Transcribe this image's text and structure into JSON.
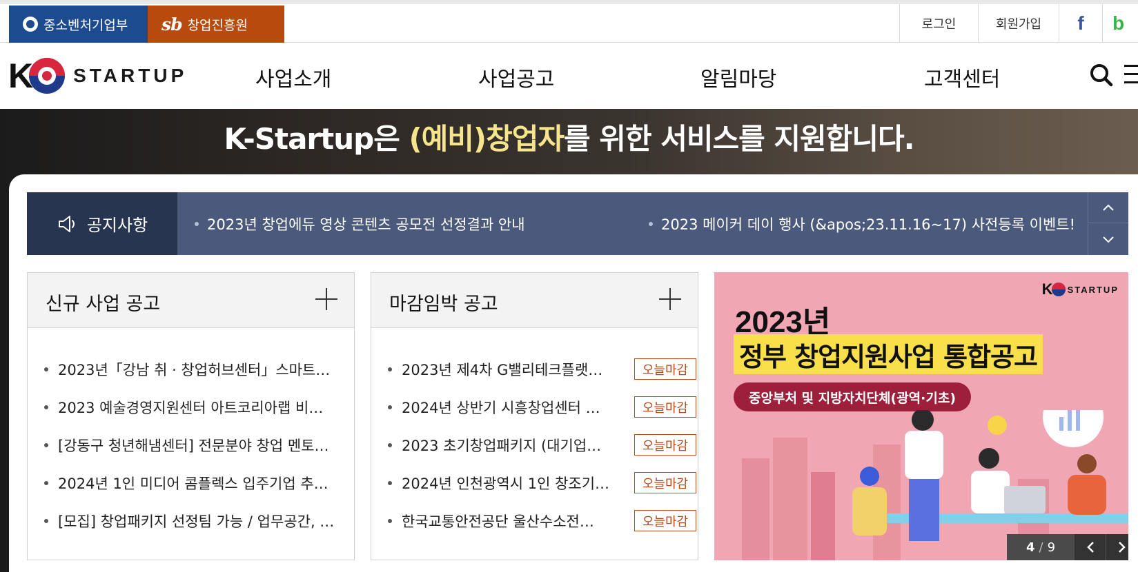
{
  "topbar": {
    "org_mss": "중소벤처기업부",
    "org_kised_mark": "sb",
    "org_kised": "창업진흥원",
    "login": "로그인",
    "join": "회원가입",
    "facebook_glyph": "f",
    "blog_glyph": "b",
    "colors": {
      "mss": "#1d4b8f",
      "kised": "#b94a0e"
    }
  },
  "header": {
    "logo_k": "K",
    "logo_word": "STARTUP",
    "nav": [
      "사업소개",
      "사업공고",
      "알림마당",
      "고객센터"
    ],
    "icons": [
      "search-icon",
      "menu-icon"
    ]
  },
  "hero": {
    "title_pre": "K-Startup은 ",
    "title_highlight": "(예비)창업자",
    "title_post": "를 위한 서비스를 지원합니다."
  },
  "notice": {
    "label": "공지사항",
    "items": [
      "2023년 창업에듀 영상 콘텐츠 공모전 선정결과 안내",
      "2023 메이커 데이 행사 (&apos;23.11.16~17) 사전등록 이벤트!"
    ]
  },
  "new_business": {
    "title": "신규 사업 공고",
    "items": [
      "2023년「강남 취 · 창업허브센터」스마트…",
      "2023 예술경영지원센터 아트코리아랩 비…",
      "[강동구 청년해냄센터] 전문분야 창업 멘토…",
      "2024년 1인 미디어 콤플렉스 입주기업 추…",
      "[모집] 창업패키지 선정팀 가능 / 업무공간, …"
    ]
  },
  "deadline": {
    "title": "마감임박 공고",
    "tag_label": "오늘마감",
    "items": [
      "2023년 제4차 G밸리테크플랫…",
      "2024년 상반기 시흥창업센터 …",
      "2023 초기창업패키지 (대기업…",
      "2024년 인천광역시 1인 창조기…",
      "한국교통안전공단 울산수소전…"
    ]
  },
  "banner": {
    "logo_k": "K",
    "logo_word": "STARTUP",
    "year": "2023년",
    "title": "정부 창업지원사업 통합공고",
    "subtitle": "중앙부처 및 지방자치단체(광역·기초)",
    "current": "4",
    "separator": "/",
    "total": "9"
  }
}
